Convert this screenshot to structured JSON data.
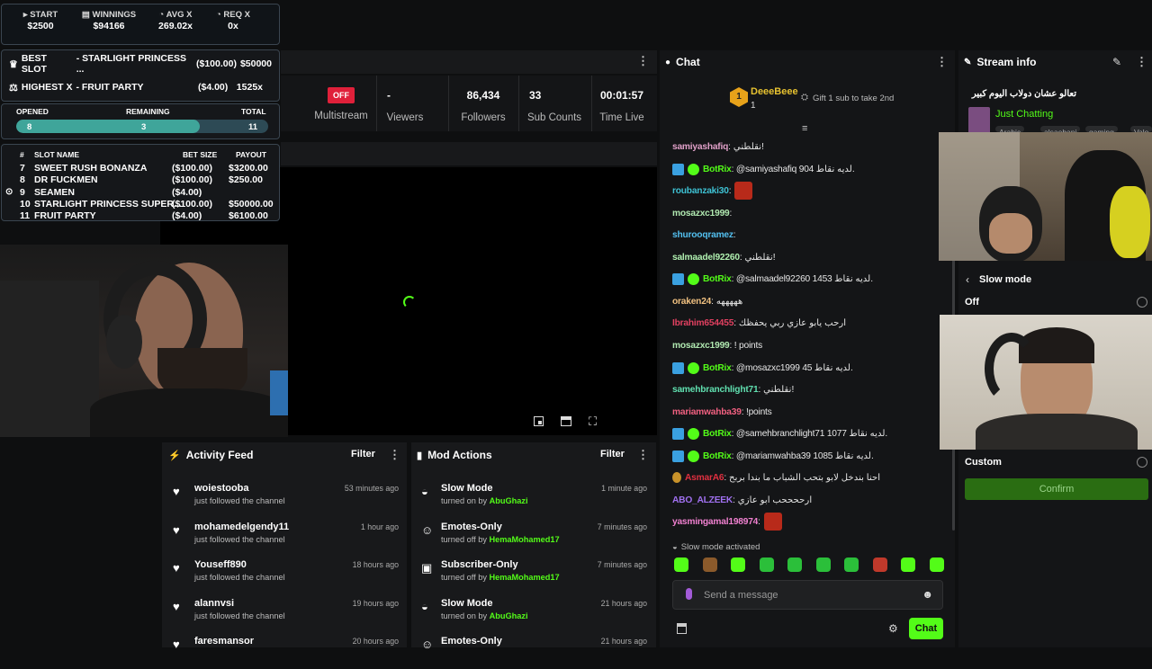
{
  "overlay": {
    "stats": [
      {
        "label": "▸ START",
        "value": "$2500"
      },
      {
        "label": "▤ WINNINGS",
        "value": "$94166"
      },
      {
        "label": "◔ AVG X",
        "value": "269.02x"
      },
      {
        "label": "◔ REQ X",
        "value": "0x"
      }
    ],
    "best": {
      "label": "BEST SLOT",
      "name": "- STARLIGHT PRINCESS ...",
      "bet": "($100.00)",
      "payout": "$50000"
    },
    "highest": {
      "label": "HIGHEST X",
      "name": "- FRUIT PARTY",
      "bet": "($4.00)",
      "mult": "1525x"
    },
    "progress": {
      "opened_label": "OPENED",
      "remaining_label": "REMAINING",
      "total_label": "TOTAL",
      "opened": "8",
      "remaining": "3",
      "total": "11",
      "fraction": 0.727
    },
    "table": {
      "headers": [
        "#",
        "SLOT NAME",
        "BET SIZE",
        "PAYOUT"
      ],
      "rows": [
        {
          "n": "7",
          "name": "SWEET RUSH BONANZA",
          "bet": "($100.00)",
          "pay": "$3200.00"
        },
        {
          "n": "8",
          "name": "DR FUCKMEN",
          "bet": "($100.00)",
          "pay": "$250.00"
        },
        {
          "n": "9",
          "name": "SEAMEN",
          "bet": "($4.00)",
          "pay": ""
        },
        {
          "n": "10",
          "name": "STARLIGHT PRINCESS SUPER...",
          "bet": "($100.00)",
          "pay": "$50000.00"
        },
        {
          "n": "11",
          "name": "FRUIT PARTY",
          "bet": "($4.00)",
          "pay": "$6100.00"
        }
      ]
    }
  },
  "stream": {
    "multistream_badge": "OFF",
    "multistream": "Multistream",
    "viewers_val": "-",
    "viewers": "Viewers",
    "followers_val": "86,434",
    "followers": "Followers",
    "subs_val": "33",
    "subs": "Sub Counts",
    "time_val": "00:01:57",
    "time": "Time Live"
  },
  "chat": {
    "title": "Chat",
    "top_user": "DeeeBeee",
    "top_rank": "1",
    "top_count": "1",
    "gift_text": "Gift 1 sub to take 2nd",
    "messages": [
      {
        "user": "samiyashafiq",
        "color": "#e0a0c8",
        "text": ": نقلطني!",
        "bot": false
      },
      {
        "user": "BotRix",
        "color": "#53fc18",
        "text": ": @samiyashafiq 904 لديه نقاط.",
        "bot": true
      },
      {
        "user": "roubanzaki30",
        "color": "#3ec1d3",
        "text": ":",
        "emote": true,
        "bot": false
      },
      {
        "user": "mosazxc1999",
        "color": "#b0e8b0",
        "text": ":",
        "bot": false
      },
      {
        "user": "shurooqramez",
        "color": "#53c0f0",
        "text": ":",
        "bot": false
      },
      {
        "user": "salmaadel92260",
        "color": "#b0f0b0",
        "text": ": نقلطني!",
        "bot": false
      },
      {
        "user": "BotRix",
        "color": "#53fc18",
        "text": ": @salmaadel92260 1453 لديه نقاط.",
        "bot": true
      },
      {
        "user": "oraken24",
        "color": "#f0c080",
        "text": ": هههههه",
        "bot": false
      },
      {
        "user": "Ibrahim654455",
        "color": "#e04060",
        "text": ": ارحب يابو عازي ربي يحفظك",
        "bot": false
      },
      {
        "user": "mosazxc1999",
        "color": "#b0e8b0",
        "text": ": ! points",
        "bot": false
      },
      {
        "user": "BotRix",
        "color": "#53fc18",
        "text": ": @mosazxc1999 45 لديه نقاط.",
        "bot": true
      },
      {
        "user": "samehbranchlight71",
        "color": "#60e0b0",
        "text": ": نقلطني!",
        "bot": false
      },
      {
        "user": "mariamwahba39",
        "color": "#f06080",
        "text": ": !points",
        "bot": false
      },
      {
        "user": "BotRix",
        "color": "#53fc18",
        "text": ": @samehbranchlight71 1077 لديه نقاط.",
        "bot": true
      },
      {
        "user": "BotRix",
        "color": "#53fc18",
        "text": ": @mariamwahba39 1085 لديه نقاط.",
        "bot": true
      },
      {
        "user": "AsmarA6",
        "color": "#e03040",
        "text": ": احنا بندخل لابو بتحب الشباب ما بندا بربح",
        "bot": false
      },
      {
        "user": "ABO_ALZEEK",
        "color": "#a070f0",
        "text": ": ارححححب ابو عازي",
        "bot": false
      },
      {
        "user": "yasmingamal198974",
        "color": "#f080d0",
        "text": ":",
        "emote": true,
        "bot": false
      }
    ],
    "slow_notice": "Slow mode activated",
    "placeholder": "Send a message",
    "send": "Chat"
  },
  "info": {
    "title": "Stream info",
    "stream_title": "تعالو عشان دولاب اليوم كبير",
    "category": "Just Chatting",
    "tags": [
      "Arabic",
      "alsaebani",
      "gaming",
      "Valo"
    ],
    "slow_label": "Slow mode",
    "off": "Off",
    "custom": "Custom",
    "confirm": "Confirm"
  },
  "feed": {
    "title": "Activity Feed",
    "filter": "Filter",
    "items": [
      {
        "name": "woiestooba",
        "sub": "just followed the channel",
        "time": "53 minutes ago"
      },
      {
        "name": "mohamedelgendy11",
        "sub": "just followed the channel",
        "time": "1 hour ago"
      },
      {
        "name": "Youseff890",
        "sub": "just followed the channel",
        "time": "18 hours ago"
      },
      {
        "name": "alannvsi",
        "sub": "just followed the channel",
        "time": "19 hours ago"
      },
      {
        "name": "faresmansor",
        "sub": "",
        "time": "20 hours ago"
      }
    ]
  },
  "mod": {
    "title": "Mod Actions",
    "filter": "Filter",
    "items": [
      {
        "name": "Slow Mode",
        "sub": "turned on by",
        "who": "AbuGhazi",
        "time": "1 minute ago"
      },
      {
        "name": "Emotes-Only",
        "sub": "turned off by",
        "who": "HemaMohamed17",
        "time": "7 minutes ago"
      },
      {
        "name": "Subscriber-Only",
        "sub": "turned off by",
        "who": "HemaMohamed17",
        "time": "7 minutes ago"
      },
      {
        "name": "Slow Mode",
        "sub": "turned on by",
        "who": "AbuGhazi",
        "time": "21 hours ago"
      },
      {
        "name": "Emotes-Only",
        "sub": "",
        "who": "",
        "time": "21 hours ago"
      }
    ]
  }
}
